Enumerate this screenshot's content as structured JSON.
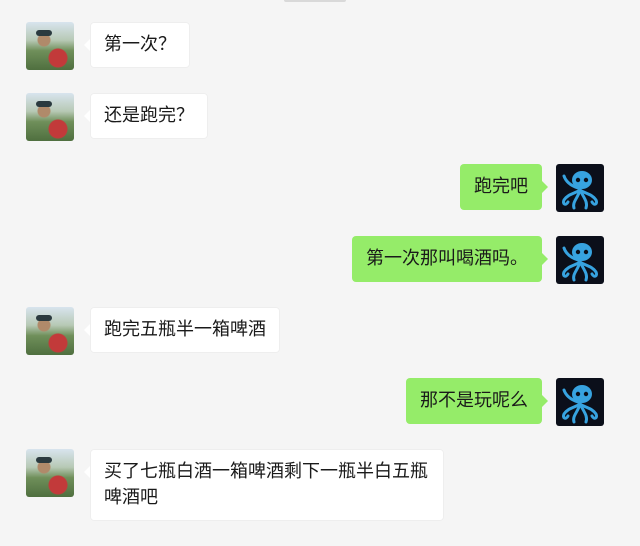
{
  "messages": [
    {
      "side": "left",
      "text": "第一次？",
      "avatar_icon": "friend-avatar"
    },
    {
      "side": "left",
      "text": "还是跑完？",
      "avatar_icon": "friend-avatar"
    },
    {
      "side": "right",
      "text": "跑完吧",
      "avatar_icon": "octopus-avatar"
    },
    {
      "side": "right",
      "text": "第一次那叫喝酒吗。",
      "avatar_icon": "octopus-avatar"
    },
    {
      "side": "left",
      "text": "跑完五瓶半一箱啤酒",
      "avatar_icon": "friend-avatar"
    },
    {
      "side": "right",
      "text": "那不是玩呢么",
      "avatar_icon": "octopus-avatar"
    },
    {
      "side": "left",
      "text": "买了七瓶白酒一箱啤酒剩下一瓶半白五瓶啤酒吧",
      "avatar_icon": "friend-avatar"
    }
  ],
  "colors": {
    "background": "#f5f5f5",
    "incoming_bubble": "#ffffff",
    "outgoing_bubble": "#95ec69"
  }
}
